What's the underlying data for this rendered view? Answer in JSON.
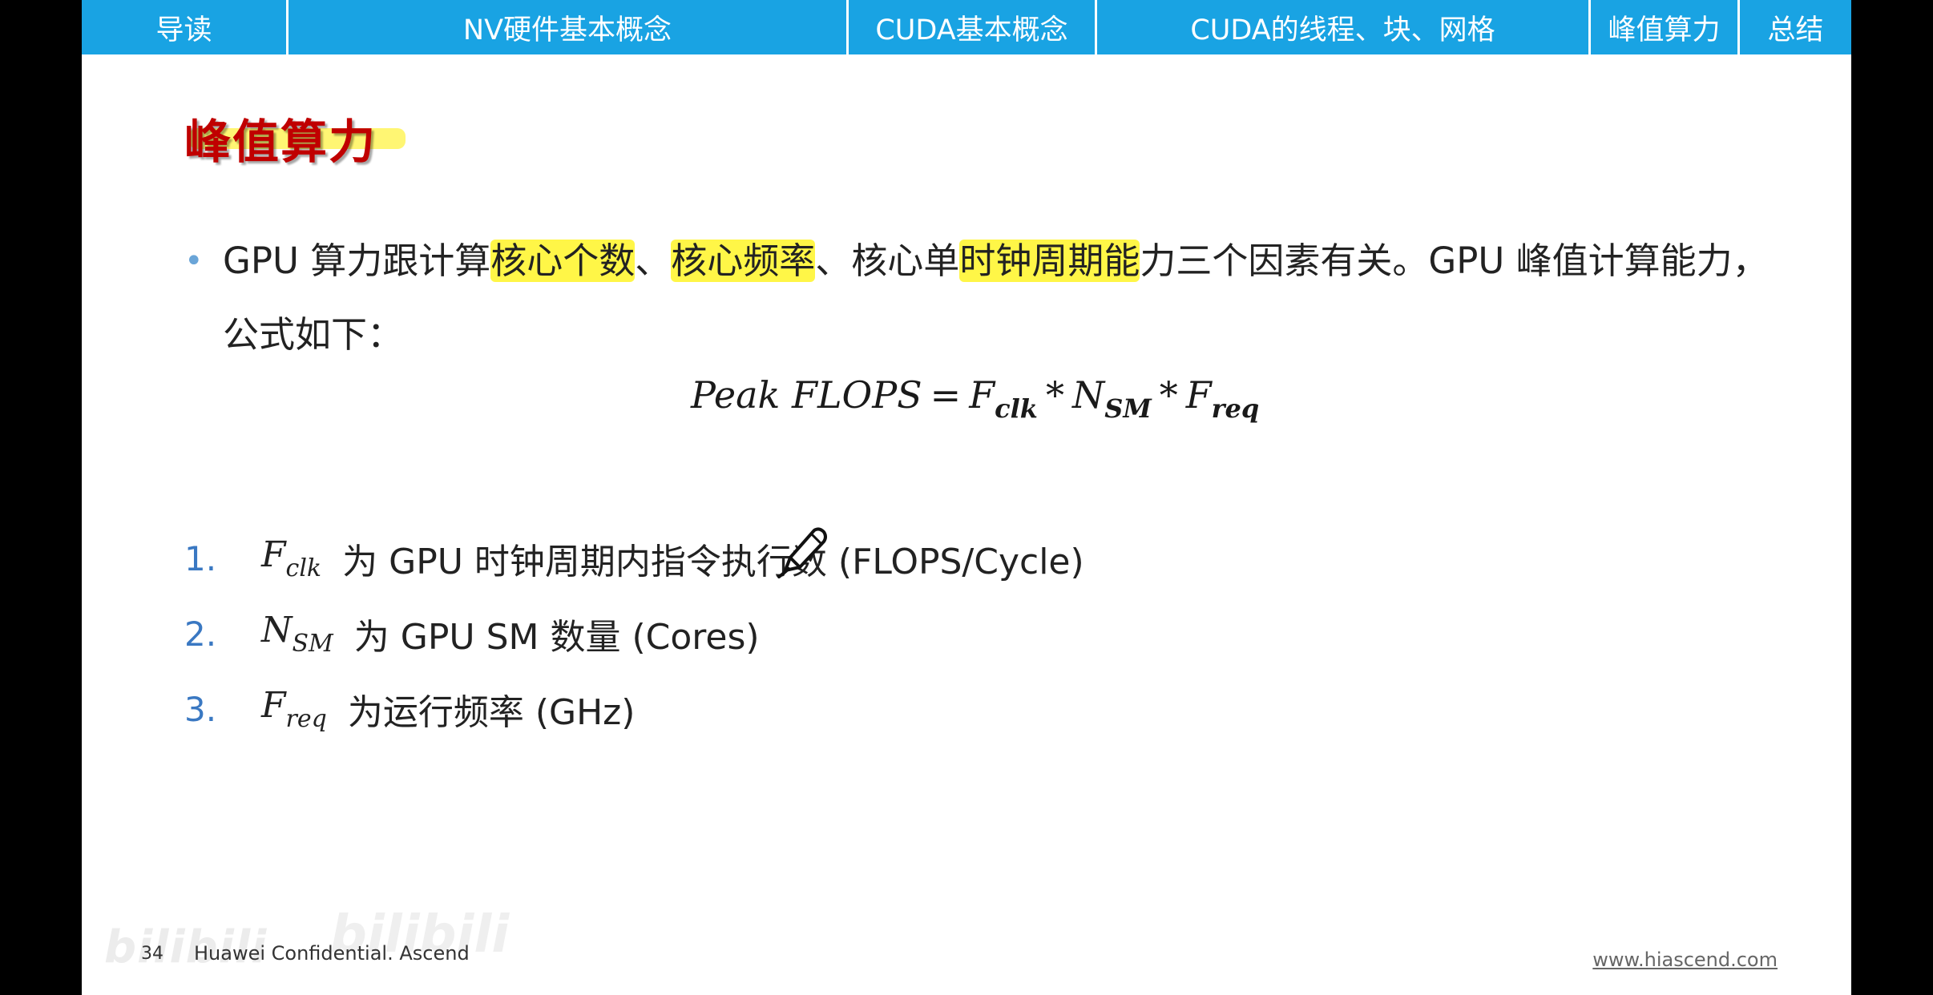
{
  "navbar": {
    "tabs": [
      {
        "label": "导读"
      },
      {
        "label": "NV硬件基本概念"
      },
      {
        "label": "CUDA基本概念"
      },
      {
        "label": "CUDA的线程、块、网格"
      },
      {
        "label": "峰值算力"
      },
      {
        "label": "总结"
      }
    ],
    "color": "#19a3e3"
  },
  "slide": {
    "title": "峰值算力",
    "title_color": "#c00000",
    "bullet": {
      "part1": "GPU 算力跟计算",
      "hl1": "核心个数",
      "part2": "、",
      "hl2": "核心频率",
      "part3": "、核心单",
      "hl3": "时钟周期能",
      "part4": "力三个因素有关。GPU 峰值计算能力，公式如下："
    },
    "formula": {
      "lhs": "Peak FLOPS",
      "eq": "=",
      "f_clk": "F",
      "f_clk_sub": "clk",
      "op1": "*",
      "n_sm": "N",
      "n_sm_sub": "SM",
      "op2": "*",
      "f_req": "F",
      "f_req_sub": "req"
    },
    "list": [
      {
        "num": "1.",
        "var": "F",
        "sub": "clk",
        "text": "为 GPU 时钟周期内指令执行数 (FLOPS/Cycle)"
      },
      {
        "num": "2.",
        "var": "N",
        "sub": "SM",
        "text": "为 GPU SM 数量 (Cores)"
      },
      {
        "num": "3.",
        "var": "F",
        "sub": "req",
        "text": "为运行频率 (GHz)"
      }
    ]
  },
  "footer": {
    "page": "34",
    "confidential": "Huawei Confidential. Ascend",
    "url": "www.hiascend.com"
  },
  "watermark": {
    "logo1": "bilibili",
    "logo2": "bilibili"
  }
}
